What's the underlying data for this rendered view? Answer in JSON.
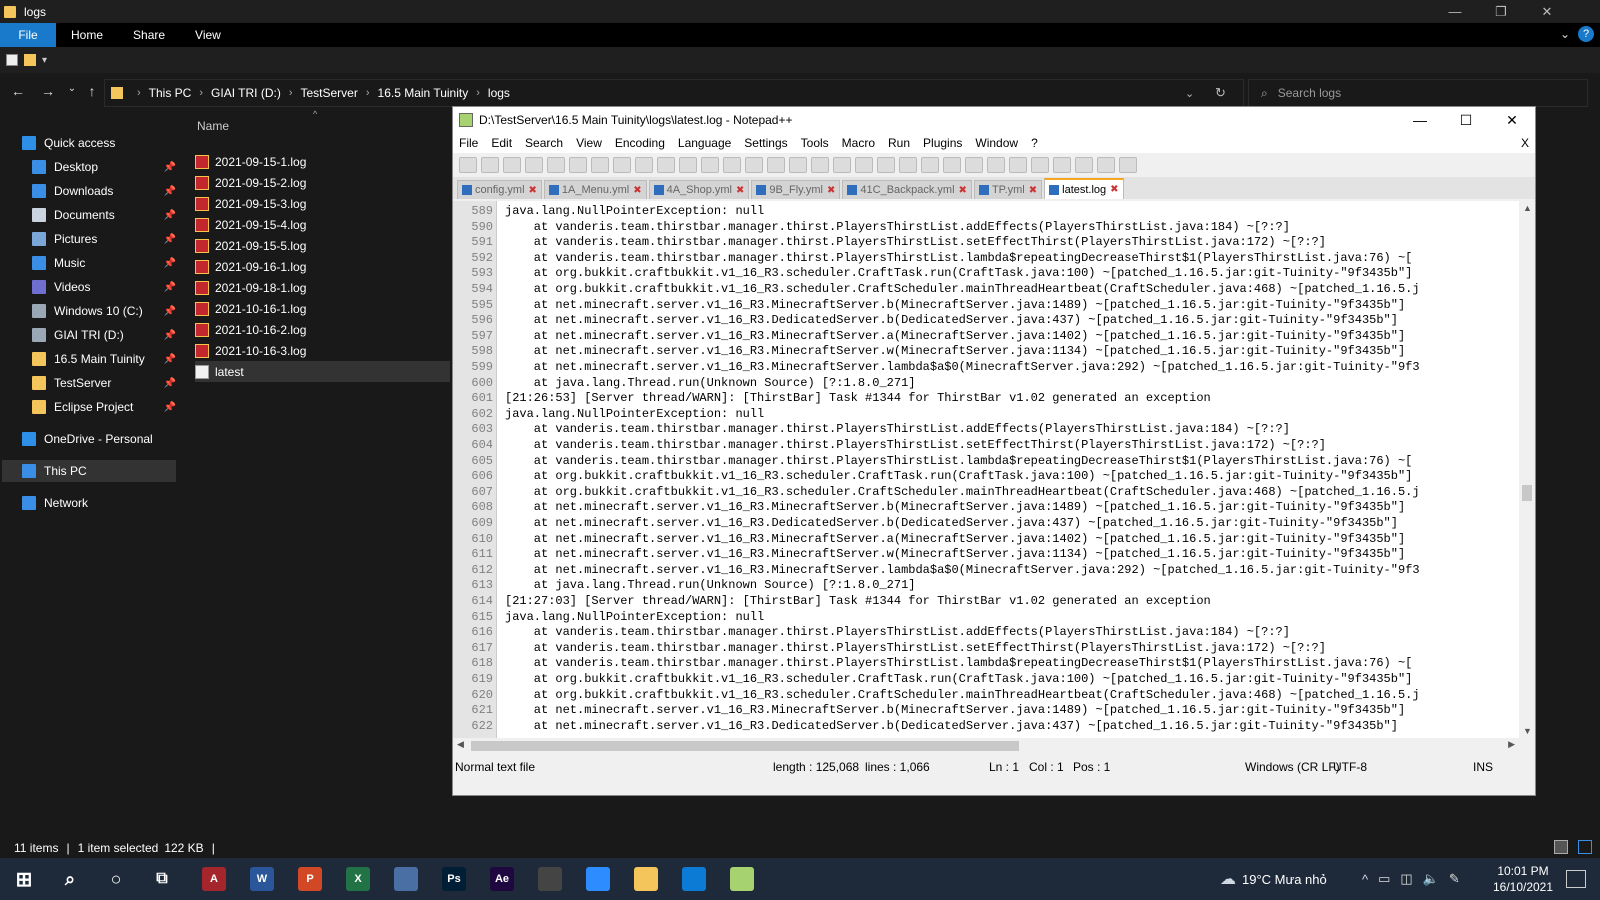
{
  "explorer": {
    "window_title": "logs",
    "ribbon_tabs": [
      "File",
      "Home",
      "Share",
      "View"
    ],
    "breadcrumb": [
      "This PC",
      "GIAI TRI (D:)",
      "TestServer",
      "16.5 Main Tuinity",
      "logs"
    ],
    "search_placeholder": "Search logs",
    "column_header": "Name",
    "nav_items": [
      {
        "label": "Quick access",
        "icon": "star-icon",
        "color": "#2d8fe8",
        "pinned": false
      },
      {
        "label": "Desktop",
        "icon": "desktop-icon",
        "color": "#3a8ee6",
        "pinned": true
      },
      {
        "label": "Downloads",
        "icon": "download-icon",
        "color": "#3a8ee6",
        "pinned": true
      },
      {
        "label": "Documents",
        "icon": "documents-icon",
        "color": "#c9d4e0",
        "pinned": true
      },
      {
        "label": "Pictures",
        "icon": "pictures-icon",
        "color": "#7aa7d8",
        "pinned": true
      },
      {
        "label": "Music",
        "icon": "music-icon",
        "color": "#3a8ee6",
        "pinned": true
      },
      {
        "label": "Videos",
        "icon": "videos-icon",
        "color": "#6f6fd0",
        "pinned": true
      },
      {
        "label": "Windows 10 (C:)",
        "icon": "drive-icon",
        "color": "#9aa7b4",
        "pinned": true
      },
      {
        "label": "GIAI TRI (D:)",
        "icon": "drive-icon",
        "color": "#9aa7b4",
        "pinned": true
      },
      {
        "label": "16.5 Main Tuinity",
        "icon": "folder-icon",
        "color": "#f3c55a",
        "pinned": true
      },
      {
        "label": "TestServer",
        "icon": "folder-icon",
        "color": "#f3c55a",
        "pinned": true
      },
      {
        "label": "Eclipse Project",
        "icon": "folder-icon",
        "color": "#f3c55a",
        "pinned": true
      },
      {
        "label": "OneDrive - Personal",
        "icon": "cloud-icon",
        "color": "#2d8fe8",
        "pinned": false
      },
      {
        "label": "This PC",
        "icon": "pc-icon",
        "color": "#3a8ee6",
        "pinned": false
      },
      {
        "label": "Network",
        "icon": "network-icon",
        "color": "#3a8ee6",
        "pinned": false
      }
    ],
    "files": [
      {
        "name": "2021-09-15-1.log",
        "type": "archive"
      },
      {
        "name": "2021-09-15-2.log",
        "type": "archive"
      },
      {
        "name": "2021-09-15-3.log",
        "type": "archive"
      },
      {
        "name": "2021-09-15-4.log",
        "type": "archive"
      },
      {
        "name": "2021-09-15-5.log",
        "type": "archive"
      },
      {
        "name": "2021-09-16-1.log",
        "type": "archive"
      },
      {
        "name": "2021-09-18-1.log",
        "type": "archive"
      },
      {
        "name": "2021-10-16-1.log",
        "type": "archive"
      },
      {
        "name": "2021-10-16-2.log",
        "type": "archive"
      },
      {
        "name": "2021-10-16-3.log",
        "type": "archive"
      },
      {
        "name": "latest",
        "type": "text"
      }
    ],
    "status": {
      "items": "11 items",
      "selected": "1 item selected",
      "size": "122 KB"
    }
  },
  "notepad": {
    "title": "D:\\TestServer\\16.5 Main Tuinity\\logs\\latest.log - Notepad++",
    "menu": [
      "File",
      "Edit",
      "Search",
      "View",
      "Encoding",
      "Language",
      "Settings",
      "Tools",
      "Macro",
      "Run",
      "Plugins",
      "Window",
      "?"
    ],
    "menu_close": "X",
    "tabs": [
      {
        "label": "config.yml",
        "active": false
      },
      {
        "label": "1A_Menu.yml",
        "active": false
      },
      {
        "label": "4A_Shop.yml",
        "active": false
      },
      {
        "label": "9B_Fly.yml",
        "active": false
      },
      {
        "label": "41C_Backpack.yml",
        "active": false
      },
      {
        "label": "TP.yml",
        "active": false
      },
      {
        "label": "latest.log",
        "active": true
      }
    ],
    "lines": [
      {
        "n": "589",
        "t": "java.lang.NullPointerException: null"
      },
      {
        "n": "590",
        "t": "    at vanderis.team.thirstbar.manager.thirst.PlayersThirstList.addEffects(PlayersThirstList.java:184) ~[?:?]"
      },
      {
        "n": "591",
        "t": "    at vanderis.team.thirstbar.manager.thirst.PlayersThirstList.setEffectThirst(PlayersThirstList.java:172) ~[?:?]"
      },
      {
        "n": "592",
        "t": "    at vanderis.team.thirstbar.manager.thirst.PlayersThirstList.lambda$repeatingDecreaseThirst$1(PlayersThirstList.java:76) ~["
      },
      {
        "n": "593",
        "t": "    at org.bukkit.craftbukkit.v1_16_R3.scheduler.CraftTask.run(CraftTask.java:100) ~[patched_1.16.5.jar:git-Tuinity-\"9f3435b\"]"
      },
      {
        "n": "594",
        "t": "    at org.bukkit.craftbukkit.v1_16_R3.scheduler.CraftScheduler.mainThreadHeartbeat(CraftScheduler.java:468) ~[patched_1.16.5.j"
      },
      {
        "n": "595",
        "t": "    at net.minecraft.server.v1_16_R3.MinecraftServer.b(MinecraftServer.java:1489) ~[patched_1.16.5.jar:git-Tuinity-\"9f3435b\"]"
      },
      {
        "n": "596",
        "t": "    at net.minecraft.server.v1_16_R3.DedicatedServer.b(DedicatedServer.java:437) ~[patched_1.16.5.jar:git-Tuinity-\"9f3435b\"]"
      },
      {
        "n": "597",
        "t": "    at net.minecraft.server.v1_16_R3.MinecraftServer.a(MinecraftServer.java:1402) ~[patched_1.16.5.jar:git-Tuinity-\"9f3435b\"]"
      },
      {
        "n": "598",
        "t": "    at net.minecraft.server.v1_16_R3.MinecraftServer.w(MinecraftServer.java:1134) ~[patched_1.16.5.jar:git-Tuinity-\"9f3435b\"]"
      },
      {
        "n": "599",
        "t": "    at net.minecraft.server.v1_16_R3.MinecraftServer.lambda$a$0(MinecraftServer.java:292) ~[patched_1.16.5.jar:git-Tuinity-\"9f3"
      },
      {
        "n": "600",
        "t": "    at java.lang.Thread.run(Unknown Source) [?:1.8.0_271]"
      },
      {
        "n": "601",
        "t": "[21:26:53] [Server thread/WARN]: [ThirstBar] Task #1344 for ThirstBar v1.02 generated an exception"
      },
      {
        "n": "602",
        "t": "java.lang.NullPointerException: null"
      },
      {
        "n": "603",
        "t": "    at vanderis.team.thirstbar.manager.thirst.PlayersThirstList.addEffects(PlayersThirstList.java:184) ~[?:?]"
      },
      {
        "n": "604",
        "t": "    at vanderis.team.thirstbar.manager.thirst.PlayersThirstList.setEffectThirst(PlayersThirstList.java:172) ~[?:?]"
      },
      {
        "n": "605",
        "t": "    at vanderis.team.thirstbar.manager.thirst.PlayersThirstList.lambda$repeatingDecreaseThirst$1(PlayersThirstList.java:76) ~["
      },
      {
        "n": "606",
        "t": "    at org.bukkit.craftbukkit.v1_16_R3.scheduler.CraftTask.run(CraftTask.java:100) ~[patched_1.16.5.jar:git-Tuinity-\"9f3435b\"]"
      },
      {
        "n": "607",
        "t": "    at org.bukkit.craftbukkit.v1_16_R3.scheduler.CraftScheduler.mainThreadHeartbeat(CraftScheduler.java:468) ~[patched_1.16.5.j"
      },
      {
        "n": "608",
        "t": "    at net.minecraft.server.v1_16_R3.MinecraftServer.b(MinecraftServer.java:1489) ~[patched_1.16.5.jar:git-Tuinity-\"9f3435b\"]"
      },
      {
        "n": "609",
        "t": "    at net.minecraft.server.v1_16_R3.DedicatedServer.b(DedicatedServer.java:437) ~[patched_1.16.5.jar:git-Tuinity-\"9f3435b\"]"
      },
      {
        "n": "610",
        "t": "    at net.minecraft.server.v1_16_R3.MinecraftServer.a(MinecraftServer.java:1402) ~[patched_1.16.5.jar:git-Tuinity-\"9f3435b\"]"
      },
      {
        "n": "611",
        "t": "    at net.minecraft.server.v1_16_R3.MinecraftServer.w(MinecraftServer.java:1134) ~[patched_1.16.5.jar:git-Tuinity-\"9f3435b\"]"
      },
      {
        "n": "612",
        "t": "    at net.minecraft.server.v1_16_R3.MinecraftServer.lambda$a$0(MinecraftServer.java:292) ~[patched_1.16.5.jar:git-Tuinity-\"9f3"
      },
      {
        "n": "613",
        "t": "    at java.lang.Thread.run(Unknown Source) [?:1.8.0_271]"
      },
      {
        "n": "614",
        "t": "[21:27:03] [Server thread/WARN]: [ThirstBar] Task #1344 for ThirstBar v1.02 generated an exception"
      },
      {
        "n": "615",
        "t": "java.lang.NullPointerException: null"
      },
      {
        "n": "616",
        "t": "    at vanderis.team.thirstbar.manager.thirst.PlayersThirstList.addEffects(PlayersThirstList.java:184) ~[?:?]"
      },
      {
        "n": "617",
        "t": "    at vanderis.team.thirstbar.manager.thirst.PlayersThirstList.setEffectThirst(PlayersThirstList.java:172) ~[?:?]"
      },
      {
        "n": "618",
        "t": "    at vanderis.team.thirstbar.manager.thirst.PlayersThirstList.lambda$repeatingDecreaseThirst$1(PlayersThirstList.java:76) ~["
      },
      {
        "n": "619",
        "t": "    at org.bukkit.craftbukkit.v1_16_R3.scheduler.CraftTask.run(CraftTask.java:100) ~[patched_1.16.5.jar:git-Tuinity-\"9f3435b\"]"
      },
      {
        "n": "620",
        "t": "    at org.bukkit.craftbukkit.v1_16_R3.scheduler.CraftScheduler.mainThreadHeartbeat(CraftScheduler.java:468) ~[patched_1.16.5.j"
      },
      {
        "n": "621",
        "t": "    at net.minecraft.server.v1_16_R3.MinecraftServer.b(MinecraftServer.java:1489) ~[patched_1.16.5.jar:git-Tuinity-\"9f3435b\"]"
      },
      {
        "n": "622",
        "t": "    at net.minecraft.server.v1_16_R3.DedicatedServer.b(DedicatedServer.java:437) ~[patched_1.16.5.jar:git-Tuinity-\"9f3435b\"]"
      }
    ],
    "status": {
      "type": "Normal text file",
      "length": "length : 125,068",
      "lines": "lines : 1,066",
      "ln": "Ln : 1",
      "col": "Col : 1",
      "pos": "Pos : 1",
      "eol": "Windows (CR LF)",
      "encoding": "UTF-8",
      "mode": "INS"
    }
  },
  "taskbar": {
    "apps": [
      {
        "name": "windows-start-icon",
        "label": "",
        "color": "#1e2a3a"
      },
      {
        "name": "search-icon",
        "label": "",
        "color": "#1e2a3a"
      },
      {
        "name": "cortana-icon",
        "label": "",
        "color": "#1e2a3a"
      },
      {
        "name": "task-view-icon",
        "label": "",
        "color": "#1e2a3a"
      },
      {
        "name": "access-icon",
        "label": "A",
        "color": "#a4262c"
      },
      {
        "name": "word-icon",
        "label": "W",
        "color": "#2b579a"
      },
      {
        "name": "powerpoint-icon",
        "label": "P",
        "color": "#d24726"
      },
      {
        "name": "excel-icon",
        "label": "X",
        "color": "#217346"
      },
      {
        "name": "store-icon",
        "label": "",
        "color": "#4a6fa5"
      },
      {
        "name": "photoshop-icon",
        "label": "Ps",
        "color": "#001e36"
      },
      {
        "name": "after-effects-icon",
        "label": "Ae",
        "color": "#1f0740"
      },
      {
        "name": "obs-icon",
        "label": "",
        "color": "#444"
      },
      {
        "name": "zoom-icon",
        "label": "",
        "color": "#2d8cff"
      },
      {
        "name": "file-explorer-icon",
        "label": "",
        "color": "#f3c55a"
      },
      {
        "name": "edge-icon",
        "label": "",
        "color": "#0c7bd6"
      },
      {
        "name": "notepadpp-icon",
        "label": "",
        "color": "#a6d26f"
      }
    ],
    "weather": "19°C  Mưa nhỏ",
    "time": "10:01 PM",
    "date": "16/10/2021"
  }
}
